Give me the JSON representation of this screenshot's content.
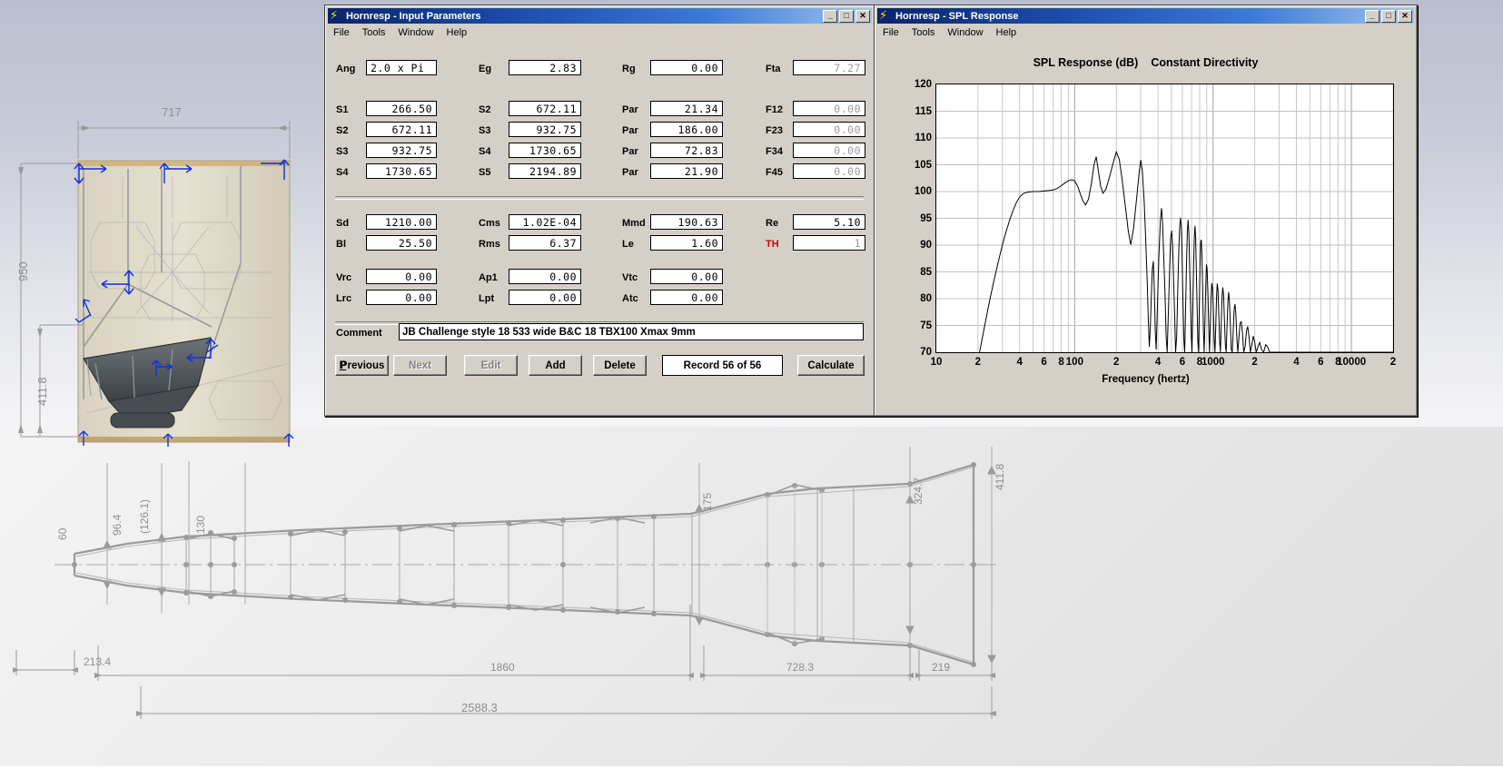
{
  "windows": {
    "input": {
      "title": "Hornresp - Input Parameters",
      "menu": [
        "File",
        "Tools",
        "Window",
        "Help"
      ],
      "buttons": {
        "minimize": "_",
        "maximize": "□",
        "close": "✕"
      },
      "fields": [
        {
          "label": "Ang",
          "value": "2.0 x Pi",
          "align": "left",
          "disabled": false
        },
        {
          "label": "Eg",
          "value": "2.83",
          "disabled": false
        },
        {
          "label": "Rg",
          "value": "0.00",
          "disabled": false
        },
        {
          "label": "Fta",
          "value": "7.27",
          "disabled": true
        },
        {
          "label": "S1",
          "value": "266.50",
          "disabled": false
        },
        {
          "label": "S2",
          "value": "672.11",
          "disabled": false
        },
        {
          "label": "Par",
          "value": "21.34",
          "disabled": false
        },
        {
          "label": "F12",
          "value": "0.00",
          "disabled": true
        },
        {
          "label": "S2",
          "value": "672.11",
          "disabled": false
        },
        {
          "label": "S3",
          "value": "932.75",
          "disabled": false
        },
        {
          "label": "Par",
          "value": "186.00",
          "disabled": false
        },
        {
          "label": "F23",
          "value": "0.00",
          "disabled": true
        },
        {
          "label": "S3",
          "value": "932.75",
          "disabled": false
        },
        {
          "label": "S4",
          "value": "1730.65",
          "disabled": false
        },
        {
          "label": "Par",
          "value": "72.83",
          "disabled": false
        },
        {
          "label": "F34",
          "value": "0.00",
          "disabled": true
        },
        {
          "label": "S4",
          "value": "1730.65",
          "disabled": false
        },
        {
          "label": "S5",
          "value": "2194.89",
          "disabled": false
        },
        {
          "label": "Par",
          "value": "21.90",
          "disabled": false
        },
        {
          "label": "F45",
          "value": "0.00",
          "disabled": true
        },
        {
          "label": "Sd",
          "value": "1210.00",
          "disabled": false
        },
        {
          "label": "Cms",
          "value": "1.02E-04",
          "disabled": false
        },
        {
          "label": "Mmd",
          "value": "190.63",
          "disabled": false
        },
        {
          "label": "Re",
          "value": "5.10",
          "disabled": false
        },
        {
          "label": "Bl",
          "value": "25.50",
          "disabled": false
        },
        {
          "label": "Rms",
          "value": "6.37",
          "disabled": false
        },
        {
          "label": "Le",
          "value": "1.60",
          "disabled": false
        },
        {
          "label": "TH",
          "value": "1",
          "disabled": true,
          "labelColor": "red"
        },
        {
          "label": "Vrc",
          "value": "0.00",
          "disabled": false
        },
        {
          "label": "Ap1",
          "value": "0.00",
          "disabled": false
        },
        {
          "label": "Vtc",
          "value": "0.00",
          "disabled": false
        },
        {
          "label": "Lrc",
          "value": "0.00",
          "disabled": false
        },
        {
          "label": "Lpt",
          "value": "0.00",
          "disabled": false
        },
        {
          "label": "Atc",
          "value": "0.00",
          "disabled": false
        }
      ],
      "comment_label": "Comment",
      "comment_value": "JB Challenge style 18  533 wide B&C 18 TBX100 Xmax 9mm",
      "actions": [
        {
          "label": "Previous",
          "accel": "P",
          "disabled": false
        },
        {
          "label": "Next",
          "accel": "N",
          "disabled": true
        },
        {
          "label": "Edit",
          "accel": "E",
          "disabled": true
        },
        {
          "label": "Add",
          "accel": "A",
          "disabled": false
        },
        {
          "label": "Delete",
          "accel": "D",
          "disabled": false
        }
      ],
      "record_status": "Record 56 of 56",
      "calculate": {
        "label": "Calculate",
        "accel": "C"
      }
    },
    "spl": {
      "title": "Hornresp - SPL Response",
      "menu": [
        "File",
        "Tools",
        "Window",
        "Help"
      ],
      "buttons": {
        "minimize": "_",
        "maximize": "□",
        "close": "✕"
      },
      "chart_title_main": "SPL Response (dB)",
      "chart_title_sub": "Constant Directivity"
    }
  },
  "chart_data": {
    "type": "line",
    "title": "SPL Response (dB)   Constant Directivity",
    "xlabel": "Frequency (hertz)",
    "ylabel": "",
    "xscale": "log",
    "xlim": [
      10,
      20000
    ],
    "ylim": [
      70,
      120
    ],
    "yticks": [
      120,
      115,
      110,
      105,
      100,
      95,
      90,
      85,
      80,
      75,
      70
    ],
    "xticks": [
      {
        "value": 10,
        "label": "10"
      },
      {
        "value": 20,
        "label": "2"
      },
      {
        "value": 40,
        "label": "4"
      },
      {
        "value": 60,
        "label": "6"
      },
      {
        "value": 80,
        "label": "8"
      },
      {
        "value": 100,
        "label": "100"
      },
      {
        "value": 200,
        "label": "2"
      },
      {
        "value": 400,
        "label": "4"
      },
      {
        "value": 600,
        "label": "6"
      },
      {
        "value": 800,
        "label": "8"
      },
      {
        "value": 1000,
        "label": "1000"
      },
      {
        "value": 2000,
        "label": "2"
      },
      {
        "value": 4000,
        "label": "4"
      },
      {
        "value": 6000,
        "label": "6"
      },
      {
        "value": 8000,
        "label": "8"
      },
      {
        "value": 10000,
        "label": "10000"
      },
      {
        "value": 20000,
        "label": "2"
      }
    ],
    "grid": true,
    "legend": null,
    "series": [
      {
        "name": "SPL",
        "color": "#000000",
        "points": [
          [
            18,
            62
          ],
          [
            20,
            68.5
          ],
          [
            22,
            74.0
          ],
          [
            24,
            79.0
          ],
          [
            26,
            83.2
          ],
          [
            28,
            86.8
          ],
          [
            30,
            90.0
          ],
          [
            32,
            92.6
          ],
          [
            34,
            94.8
          ],
          [
            36,
            96.6
          ],
          [
            38,
            98.0
          ],
          [
            40,
            99.0
          ],
          [
            43,
            99.7
          ],
          [
            46,
            99.9
          ],
          [
            50,
            100.0
          ],
          [
            55,
            100.0
          ],
          [
            60,
            100.1
          ],
          [
            65,
            100.2
          ],
          [
            70,
            100.3
          ],
          [
            75,
            100.6
          ],
          [
            80,
            101.1
          ],
          [
            85,
            101.6
          ],
          [
            90,
            102.0
          ],
          [
            95,
            102.2
          ],
          [
            100,
            102.0
          ],
          [
            105,
            101.0
          ],
          [
            110,
            99.5
          ],
          [
            115,
            98.2
          ],
          [
            120,
            97.5
          ],
          [
            126,
            98.6
          ],
          [
            132,
            101.5
          ],
          [
            138,
            105.0
          ],
          [
            143,
            106.5
          ],
          [
            148,
            104.0
          ],
          [
            154,
            101.0
          ],
          [
            160,
            99.7
          ],
          [
            168,
            100.4
          ],
          [
            178,
            102.6
          ],
          [
            190,
            105.4
          ],
          [
            200,
            107.4
          ],
          [
            210,
            106.0
          ],
          [
            220,
            102.3
          ],
          [
            232,
            97.4
          ],
          [
            244,
            92.6
          ],
          [
            254,
            90.1
          ],
          [
            266,
            93.0
          ],
          [
            280,
            98.6
          ],
          [
            292,
            103.4
          ],
          [
            300,
            105.9
          ],
          [
            308,
            104.0
          ],
          [
            318,
            98.0
          ],
          [
            326,
            91.0
          ],
          [
            334,
            83.5
          ],
          [
            340,
            76.5
          ],
          [
            346,
            71.0
          ],
          [
            352,
            74.5
          ],
          [
            358,
            80.5
          ],
          [
            364,
            85.5
          ],
          [
            370,
            87.0
          ],
          [
            376,
            82.0
          ],
          [
            382,
            74.0
          ],
          [
            388,
            70.5
          ],
          [
            396,
            78.5
          ],
          [
            406,
            88.0
          ],
          [
            416,
            94.5
          ],
          [
            424,
            96.9
          ],
          [
            432,
            94.0
          ],
          [
            440,
            88.0
          ],
          [
            450,
            80.5
          ],
          [
            458,
            73.0
          ],
          [
            466,
            70.0
          ],
          [
            476,
            78.0
          ],
          [
            486,
            86.0
          ],
          [
            494,
            91.5
          ],
          [
            502,
            92.7
          ],
          [
            510,
            90.0
          ],
          [
            518,
            84.0
          ],
          [
            528,
            76.5
          ],
          [
            536,
            70.0
          ],
          [
            546,
            73.0
          ],
          [
            556,
            82.0
          ],
          [
            566,
            89.5
          ],
          [
            574,
            93.5
          ],
          [
            582,
            95.1
          ],
          [
            590,
            93.0
          ],
          [
            598,
            87.0
          ],
          [
            606,
            79.5
          ],
          [
            616,
            72.0
          ],
          [
            624,
            70.0
          ],
          [
            634,
            79.0
          ],
          [
            644,
            87.5
          ],
          [
            652,
            92.5
          ],
          [
            660,
            94.7
          ],
          [
            668,
            92.5
          ],
          [
            676,
            87.0
          ],
          [
            686,
            80.0
          ],
          [
            696,
            73.0
          ],
          [
            704,
            70.0
          ],
          [
            714,
            78.0
          ],
          [
            724,
            86.5
          ],
          [
            732,
            91.5
          ],
          [
            740,
            93.6
          ],
          [
            748,
            91.5
          ],
          [
            756,
            86.0
          ],
          [
            766,
            79.0
          ],
          [
            776,
            72.0
          ],
          [
            786,
            70.0
          ],
          [
            796,
            79.0
          ],
          [
            806,
            87.0
          ],
          [
            814,
            90.6
          ],
          [
            822,
            91.0
          ],
          [
            832,
            87.5
          ],
          [
            842,
            81.0
          ],
          [
            852,
            74.0
          ],
          [
            862,
            70.0
          ],
          [
            874,
            76.0
          ],
          [
            886,
            82.5
          ],
          [
            896,
            86.4
          ],
          [
            906,
            85.5
          ],
          [
            918,
            81.0
          ],
          [
            930,
            75.0
          ],
          [
            942,
            70.0
          ],
          [
            954,
            74.5
          ],
          [
            966,
            80.0
          ],
          [
            978,
            82.9
          ],
          [
            990,
            82.0
          ],
          [
            1004,
            78.0
          ],
          [
            1018,
            72.5
          ],
          [
            1032,
            70.0
          ],
          [
            1046,
            75.0
          ],
          [
            1060,
            80.5
          ],
          [
            1072,
            82.8
          ],
          [
            1086,
            81.5
          ],
          [
            1100,
            77.0
          ],
          [
            1116,
            72.0
          ],
          [
            1130,
            70.0
          ],
          [
            1146,
            75.5
          ],
          [
            1162,
            80.5
          ],
          [
            1176,
            82.1
          ],
          [
            1192,
            80.5
          ],
          [
            1208,
            76.0
          ],
          [
            1226,
            71.5
          ],
          [
            1244,
            70.0
          ],
          [
            1262,
            75.0
          ],
          [
            1280,
            79.5
          ],
          [
            1296,
            81.2
          ],
          [
            1314,
            79.5
          ],
          [
            1334,
            75.0
          ],
          [
            1354,
            70.5
          ],
          [
            1376,
            70.0
          ],
          [
            1398,
            74.0
          ],
          [
            1420,
            78.0
          ],
          [
            1440,
            79.0
          ],
          [
            1462,
            77.0
          ],
          [
            1486,
            72.5
          ],
          [
            1510,
            70.0
          ],
          [
            1540,
            73.0
          ],
          [
            1570,
            75.5
          ],
          [
            1600,
            75.7
          ],
          [
            1632,
            73.5
          ],
          [
            1666,
            70.0
          ],
          [
            1704,
            71.0
          ],
          [
            1744,
            74.0
          ],
          [
            1780,
            74.8
          ],
          [
            1818,
            73.0
          ],
          [
            1860,
            70.0
          ],
          [
            1908,
            71.5
          ],
          [
            1950,
            73.0
          ],
          [
            1996,
            72.0
          ],
          [
            2050,
            70.0
          ],
          [
            2110,
            71.0
          ],
          [
            2170,
            71.8
          ],
          [
            2240,
            70.5
          ],
          [
            2320,
            70.0
          ],
          [
            2400,
            71.4
          ],
          [
            2480,
            71.0
          ],
          [
            2560,
            70.0
          ],
          [
            2700,
            70.0
          ],
          [
            2900,
            70.0
          ],
          [
            3200,
            70.0
          ],
          [
            3600,
            70.0
          ],
          [
            4200,
            70.0
          ],
          [
            5000,
            70.0
          ],
          [
            6500,
            70.0
          ],
          [
            9000,
            70.0
          ],
          [
            13000,
            70.0
          ],
          [
            20000,
            70.0
          ]
        ]
      }
    ]
  },
  "cad_front": {
    "dims": [
      {
        "name": "width-top",
        "text": "717"
      },
      {
        "name": "height-overall",
        "text": "950"
      },
      {
        "name": "height-lower",
        "text": "411.8"
      }
    ]
  },
  "cad_profile": {
    "dims": [
      {
        "name": "throat-height",
        "text": "60"
      },
      {
        "name": "dim-96",
        "text": "96.4"
      },
      {
        "name": "dim-126-ref",
        "text": "(126.1)"
      },
      {
        "name": "dim-130",
        "text": "130"
      },
      {
        "name": "dim-175",
        "text": "175"
      },
      {
        "name": "dim-324",
        "text": "324.7"
      },
      {
        "name": "mouth-height",
        "text": "411.8"
      },
      {
        "name": "len-213",
        "text": "213.4"
      },
      {
        "name": "len-1860",
        "text": "1860"
      },
      {
        "name": "len-728",
        "text": "728.3"
      },
      {
        "name": "len-219",
        "text": "219"
      },
      {
        "name": "len-total",
        "text": "2588.3"
      }
    ]
  }
}
